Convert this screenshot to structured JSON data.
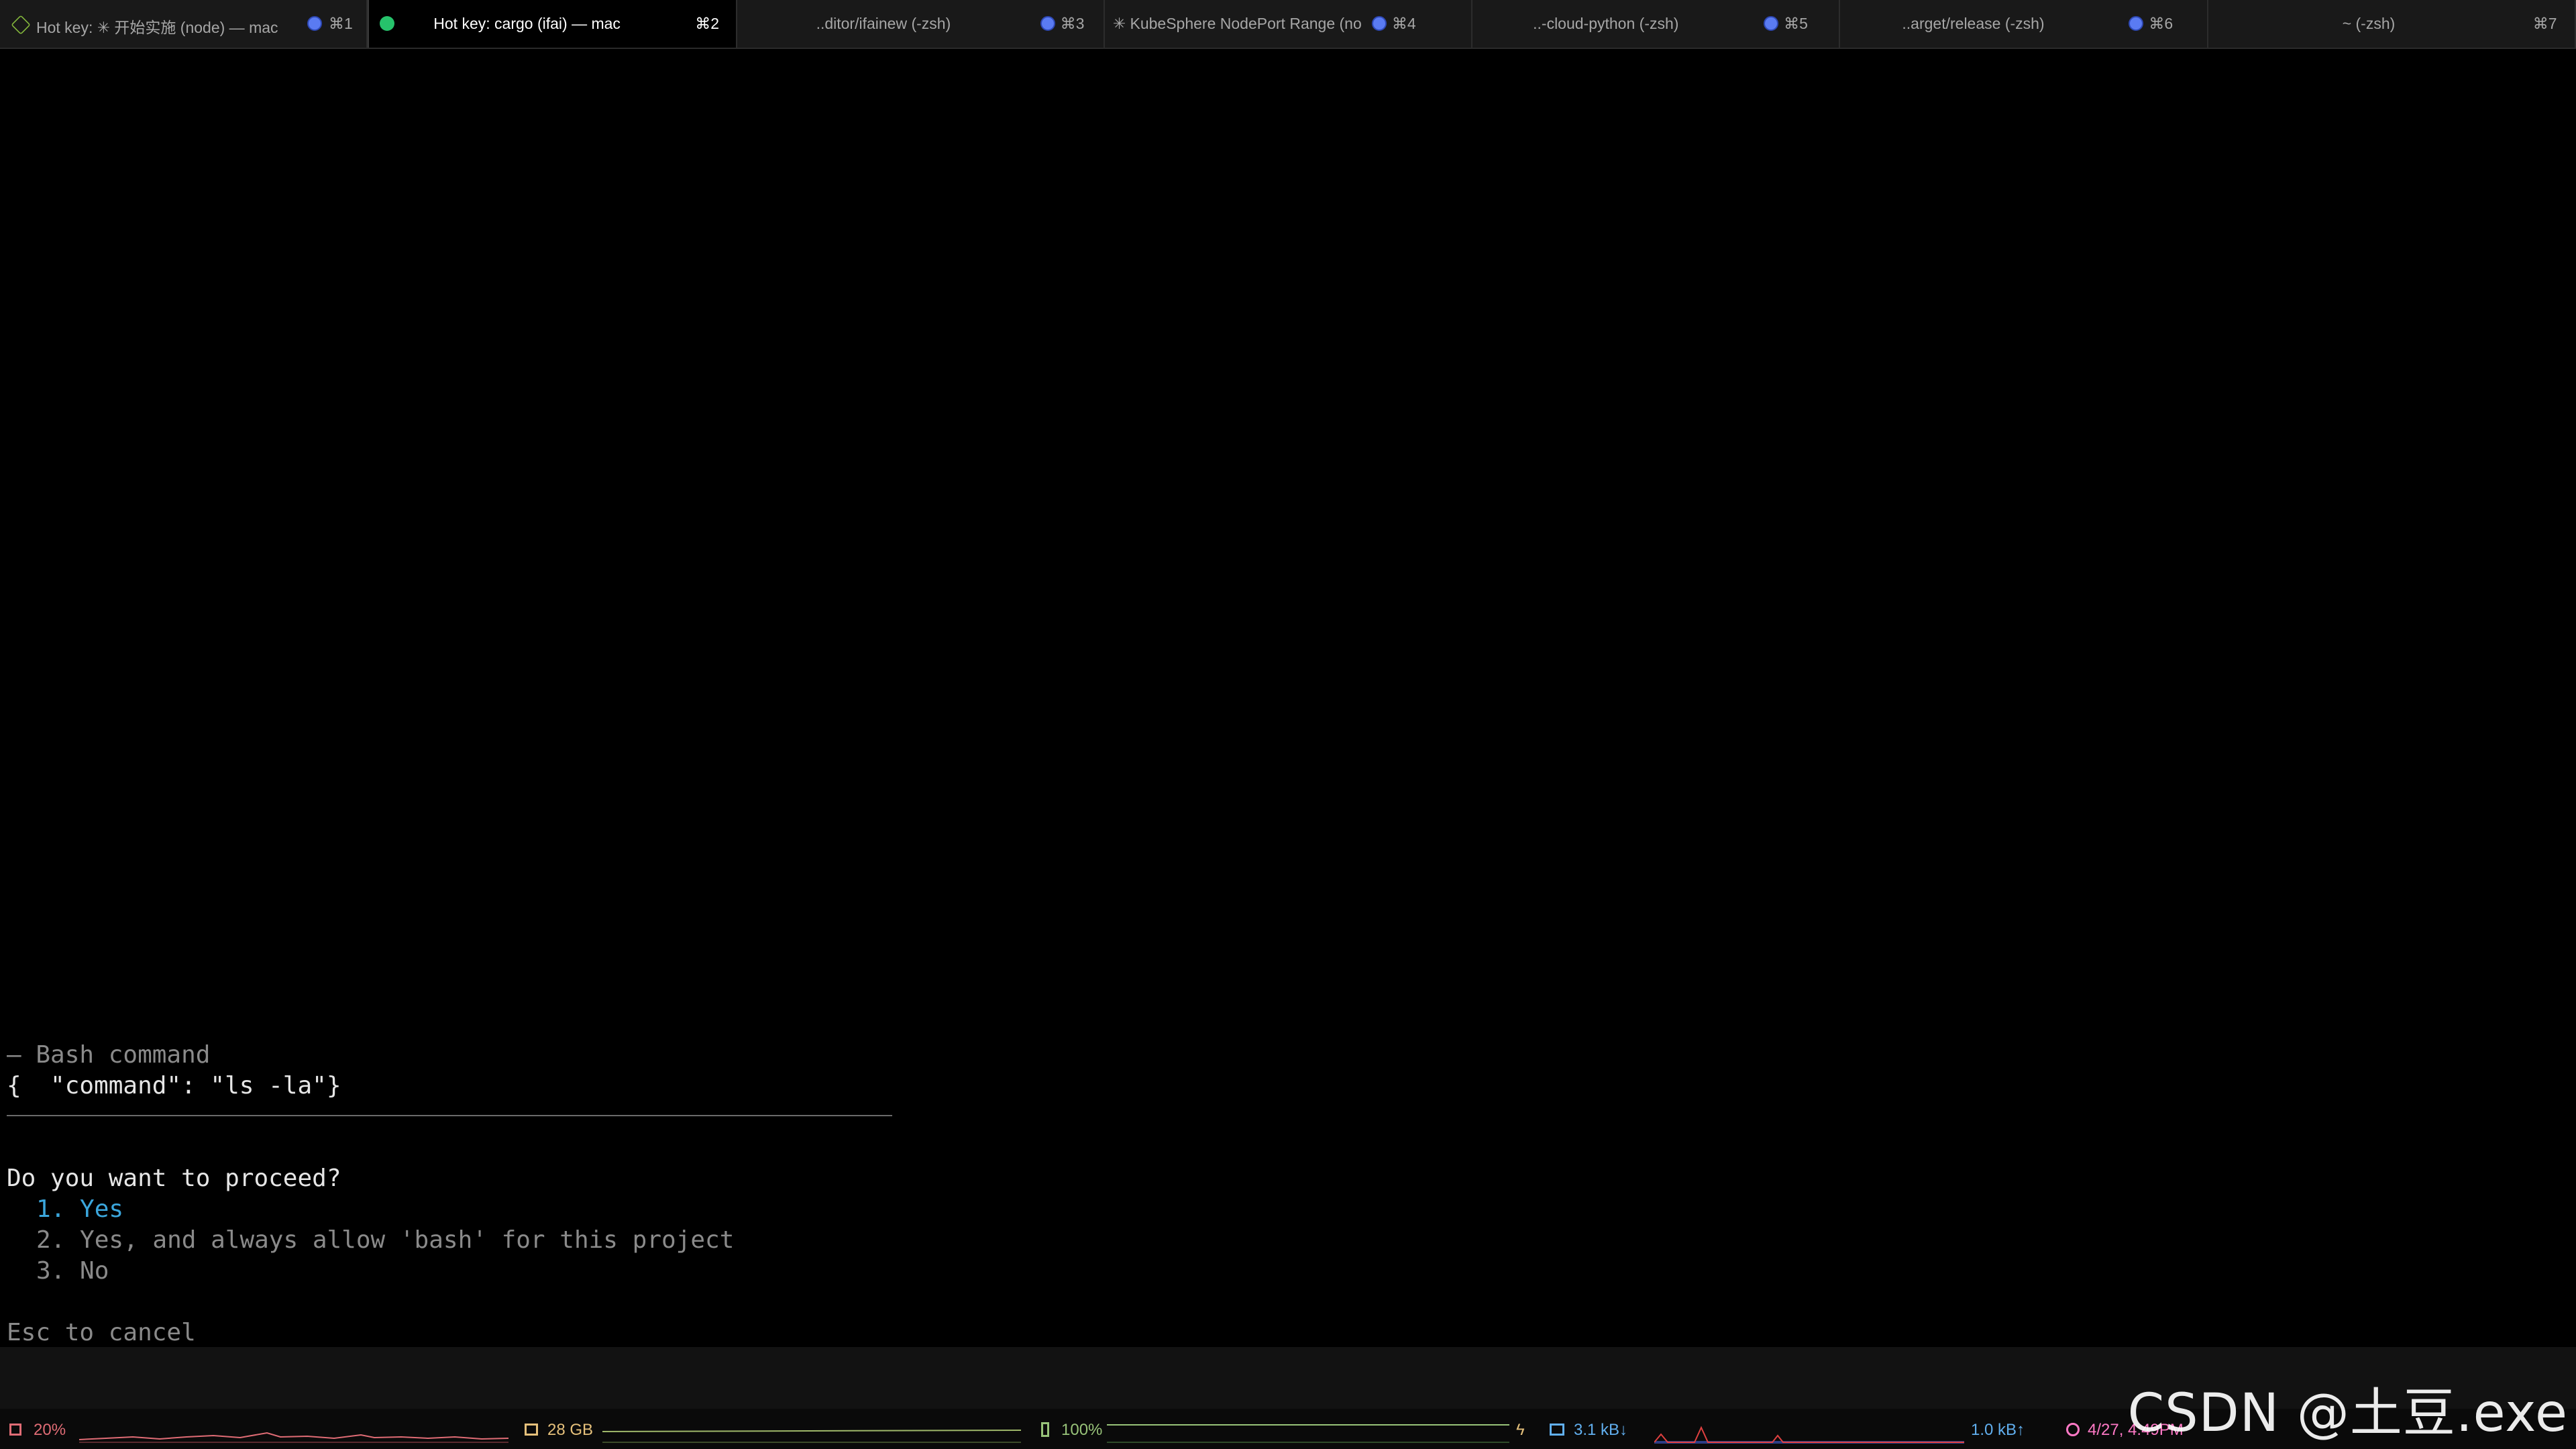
{
  "tabs": [
    {
      "title": "Hot key: ✳ 开始实施 (node) — mac",
      "shortcut": "⌘1",
      "icon": "hexagon-node-icon"
    },
    {
      "title": "Hot key: cargo (ifai) — mac",
      "shortcut": "⌘2",
      "icon": "activity-dot-icon",
      "active": true
    },
    {
      "title": "..ditor/ifainew (-zsh)",
      "shortcut": "⌘3",
      "icon": "blue-dot-icon"
    },
    {
      "title": "✳ KubeSphere NodePort Range (no...",
      "shortcut": "⌘4",
      "icon": "blue-dot-icon"
    },
    {
      "title": "..-cloud-python (-zsh)",
      "shortcut": "⌘5",
      "icon": "blue-dot-icon"
    },
    {
      "title": "..arget/release (-zsh)",
      "shortcut": "⌘6",
      "icon": "blue-dot-icon"
    },
    {
      "title": "~ (-zsh)",
      "shortcut": "⌘7",
      "icon": "blue-dot-icon"
    }
  ],
  "terminal": {
    "tool_header": "— Bash command",
    "command_json": "{  \"command\": \"ls -la\"}",
    "question": "Do you want to proceed?",
    "options": [
      {
        "num": "1.",
        "label": "Yes",
        "selected": true
      },
      {
        "num": "2.",
        "label": "Yes, and always allow 'bash' for this project",
        "selected": false
      },
      {
        "num": "3.",
        "label": "No",
        "selected": false
      }
    ],
    "cancel_hint": "Esc to cancel"
  },
  "status_bar": {
    "cpu": "20%",
    "memory": "28 GB",
    "battery": "100%",
    "net_down": "3.1 kB↓",
    "net_up": "1.0 kB↑",
    "datetime": "4/27, 4:49PM",
    "colors": {
      "cpu": "#e06c75",
      "memory": "#e5c07b",
      "battery": "#98c379",
      "network": "#61afef",
      "clock": "#ff79c6"
    }
  },
  "watermark": "CSDN @土豆.exe"
}
